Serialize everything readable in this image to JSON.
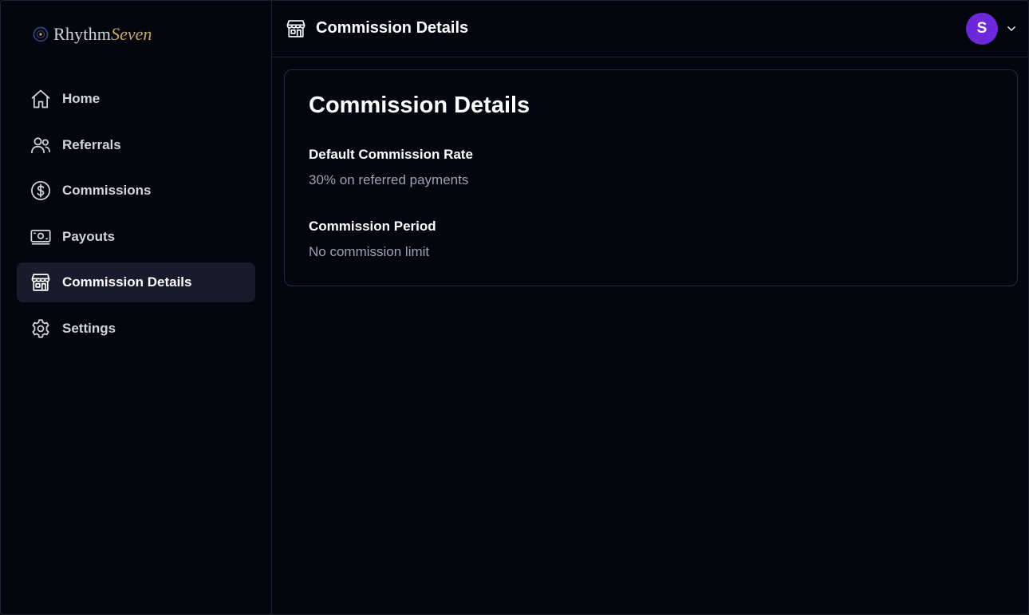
{
  "brand": {
    "word1": "Rhythm",
    "word2": "Seven",
    "accent_color": "#c9a66b"
  },
  "sidebar": {
    "items": [
      {
        "label": "Home",
        "icon": "home-icon",
        "active": false
      },
      {
        "label": "Referrals",
        "icon": "users-icon",
        "active": false
      },
      {
        "label": "Commissions",
        "icon": "dollar-circle-icon",
        "active": false
      },
      {
        "label": "Payouts",
        "icon": "banknote-icon",
        "active": false
      },
      {
        "label": "Commission Details",
        "icon": "storefront-icon",
        "active": true
      },
      {
        "label": "Settings",
        "icon": "gear-icon",
        "active": false
      }
    ]
  },
  "header": {
    "title": "Commission Details",
    "icon": "storefront-icon"
  },
  "user": {
    "initial": "S",
    "avatar_color": "#6d28d9"
  },
  "card": {
    "title": "Commission Details",
    "fields": [
      {
        "label": "Default Commission Rate",
        "value": "30% on referred payments"
      },
      {
        "label": "Commission Period",
        "value": "No commission limit"
      }
    ]
  }
}
